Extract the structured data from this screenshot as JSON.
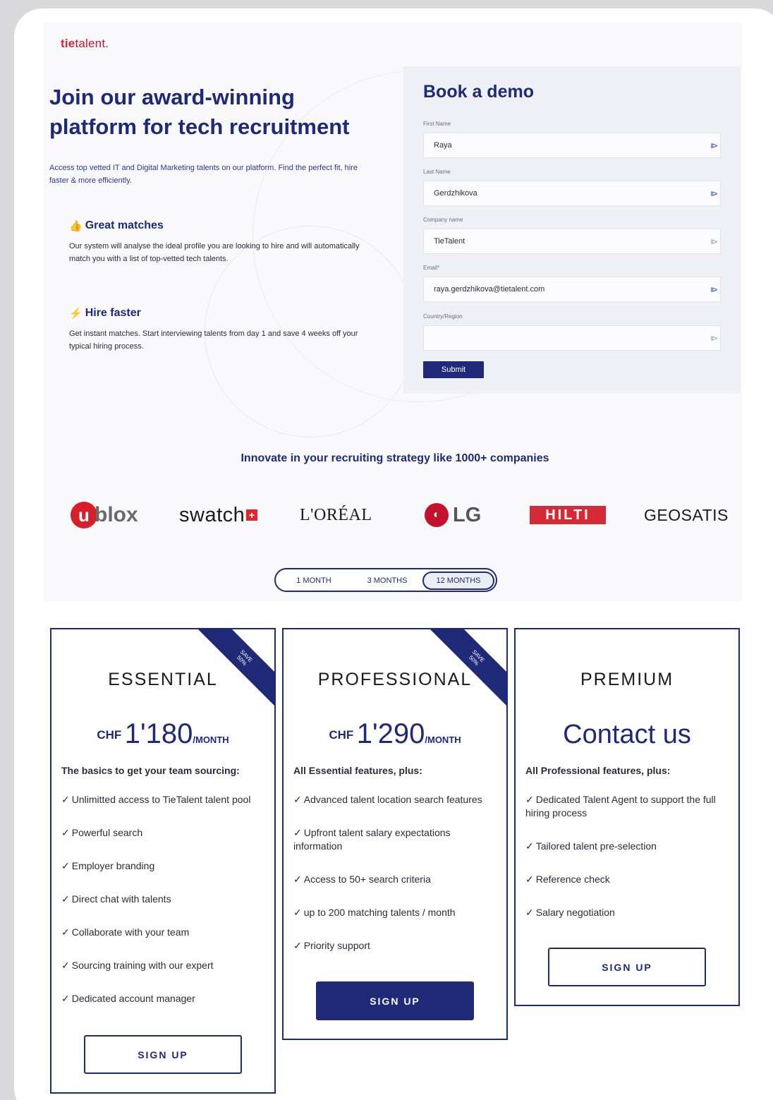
{
  "logo": {
    "tie": "tie",
    "talent": "talent."
  },
  "hero": {
    "title": "Join our award-winning platform for tech recruitment",
    "subtitle": "Access top vetted IT and Digital Marketing talents on our platform. Find the perfect fit, hire faster & more efficiently."
  },
  "features": [
    {
      "icon": "👍",
      "title": "Great matches",
      "text": "Our system will analyse the ideal profile you are looking to hire and will automatically match you with a list of top-vetted tech talents."
    },
    {
      "icon": "⚡",
      "title": "Hire faster",
      "text": "Get instant matches. Start interviewing talents from day 1 and save 4 weeks off your typical hiring process."
    }
  ],
  "demo": {
    "title": "Book a demo",
    "fields": [
      {
        "label": "First Name",
        "value": "Raya"
      },
      {
        "label": "Last Name",
        "value": "Gerdzhikova"
      },
      {
        "label": "Company name",
        "value": "TieTalent"
      },
      {
        "label": "Email*",
        "value": "raya.gerdzhikova@tietalent.com"
      },
      {
        "label": "Country/Region",
        "value": ""
      }
    ],
    "submit": "Submit"
  },
  "companies": {
    "heading": "Innovate in your recruiting strategy like 1000+ companies",
    "logos": {
      "ublox_u": "u",
      "ublox_word": "blox",
      "swatch": "swatch",
      "swatch_cross": "+",
      "loreal": "L'ORÉAL",
      "lg_mark": "◐",
      "lg_word": "LG",
      "hilti": "HILTI",
      "geosatis": "GEOSATIS"
    }
  },
  "period": {
    "options": [
      "1 MONTH",
      "3 MONTHS",
      "12 MONTHS"
    ],
    "selected": "12 MONTHS"
  },
  "plans": [
    {
      "name": "ESSENTIAL",
      "ribbon": [
        "SAVE",
        "50%"
      ],
      "currency": "CHF",
      "amount": "1'180",
      "per": "/MONTH",
      "intro": "The basics to get your team sourcing:",
      "features": [
        "Unlimitted access to TieTalent talent pool",
        "Powerful search",
        "Employer branding",
        "Direct chat with talents",
        "Collaborate with your team",
        "Sourcing training with our expert",
        "Dedicated account manager"
      ],
      "cta": "SIGN UP"
    },
    {
      "name": "PROFESSIONAL",
      "ribbon": [
        "SAVE",
        "50%"
      ],
      "currency": "CHF",
      "amount": "1'290",
      "per": "/MONTH",
      "intro": "All Essential features, plus:",
      "features": [
        "Advanced talent location search features",
        "Upfront talent salary expectations information",
        "Access to 50+ search criteria",
        "up to 200 matching talents / month",
        "Priority support"
      ],
      "cta": "SIGN UP"
    },
    {
      "name": "PREMIUM",
      "contact": "Contact us",
      "intro": "All Professional features, plus:",
      "features": [
        "Dedicated Talent Agent to support the full hiring process",
        "Tailored talent pre-selection",
        "Reference check",
        "Salary negotiation"
      ],
      "cta": "SIGN UP"
    }
  ],
  "check_mark": "✓",
  "autofill_icon": "⧐",
  "colors": {
    "brand_navy": "#1e2a78",
    "logo_red": "#d3223a",
    "background": "#f9f9fb"
  }
}
